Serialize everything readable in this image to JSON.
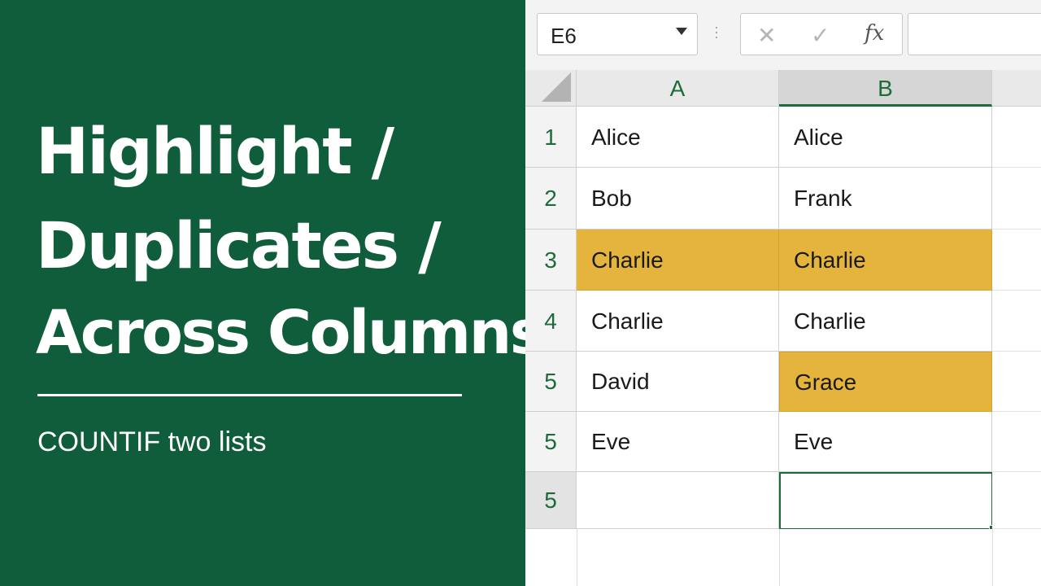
{
  "title": {
    "line1": "Highlight /",
    "line2": "Duplicates /",
    "line3": "Across Columns"
  },
  "subtitle": "COUNTIF two lists",
  "colors": {
    "panel_green": "#0f5d3a",
    "highlight": "#e5b43c",
    "excel_green": "#1e6b3a"
  },
  "formula_bar": {
    "name_box": "E6",
    "cancel_icon": "close-icon",
    "enter_icon": "check-icon",
    "fx_label": "fx",
    "formula": ""
  },
  "columns": [
    "A",
    "B"
  ],
  "rows": [
    {
      "header": "1",
      "a": "Alice",
      "b": "Alice",
      "a_highlight": false,
      "b_highlight": false
    },
    {
      "header": "2",
      "a": "Bob",
      "b": "Frank",
      "a_highlight": false,
      "b_highlight": false
    },
    {
      "header": "3",
      "a": "Charlie",
      "b": "Charlie",
      "a_highlight": true,
      "b_highlight": true
    },
    {
      "header": "4",
      "a": "Charlie",
      "b": "Charlie",
      "a_highlight": false,
      "b_highlight": false
    },
    {
      "header": "5",
      "a": "David",
      "b": "Grace",
      "a_highlight": false,
      "b_highlight": true
    },
    {
      "header": "5",
      "a": "Eve",
      "b": "Eve",
      "a_highlight": false,
      "b_highlight": false
    },
    {
      "header": "5",
      "a": "",
      "b": "",
      "a_highlight": false,
      "b_highlight": false
    }
  ]
}
